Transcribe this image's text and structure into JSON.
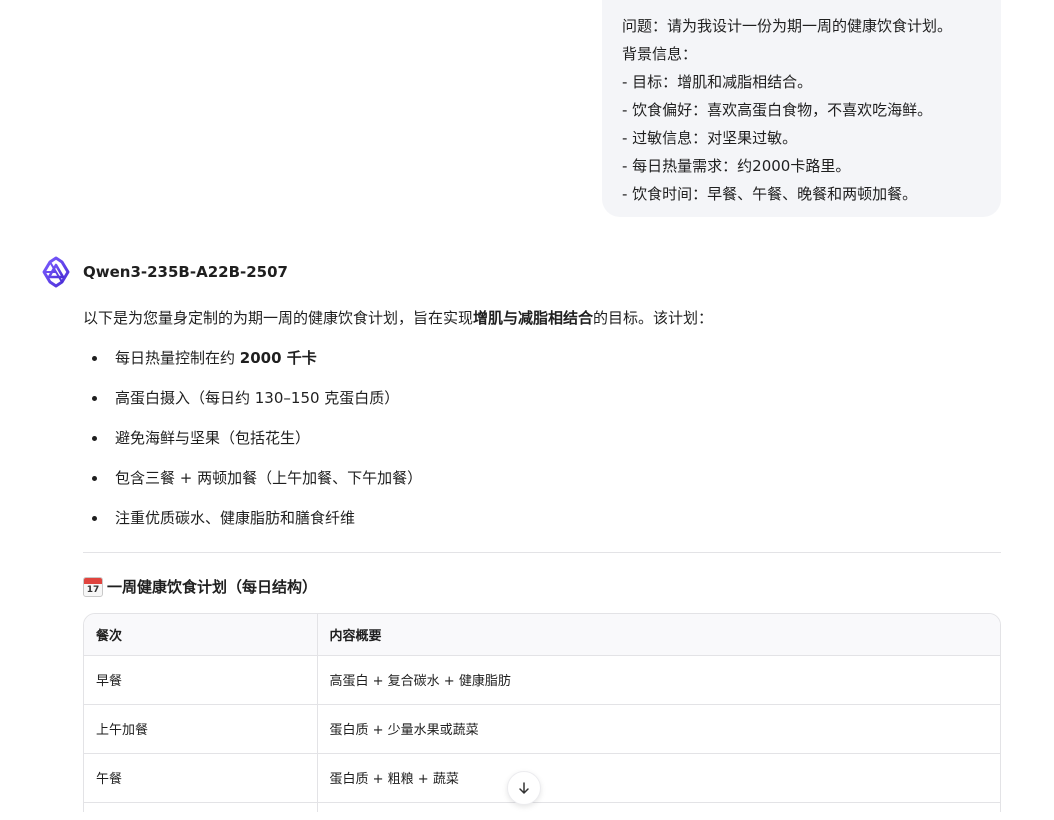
{
  "user_message": {
    "lines": [
      "问题：请为我设计一份为期一周的健康饮食计划。",
      "背景信息：",
      "- 目标：增肌和减脂相结合。",
      "- 饮食偏好：喜欢高蛋白食物，不喜欢吃海鲜。",
      "- 过敏信息：对坚果过敏。",
      "- 每日热量需求：约2000卡路里。",
      "- 饮食时间：早餐、午餐、晚餐和两顿加餐。"
    ]
  },
  "assistant": {
    "model_name": "Qwen3-235B-A22B-2507",
    "logo_icon": "qwen-logo-icon",
    "intro_before": "以下是为您量身定制的为期一周的健康饮食计划，旨在实现",
    "intro_bold": "增肌与减脂相结合",
    "intro_after": "的目标。该计划：",
    "bullets": [
      {
        "text": "每日热量控制在约 ",
        "bold": "2000 千卡"
      },
      {
        "text": "高蛋白摄入（每日约 130–150 克蛋白质）",
        "bold": ""
      },
      {
        "text": "避免海鲜与坚果（包括花生）",
        "bold": ""
      },
      {
        "text": "包含三餐 + 两顿加餐（上午加餐、下午加餐）",
        "bold": ""
      },
      {
        "text": "注重优质碳水、健康脂肪和膳食纤维",
        "bold": ""
      }
    ],
    "section_icon": "calendar-icon",
    "section_icon_day": "17",
    "section_title": "一周健康饮食计划（每日结构）",
    "table": {
      "headers": [
        "餐次",
        "内容概要"
      ],
      "rows": [
        [
          "早餐",
          "高蛋白 + 复合碳水 + 健康脂肪"
        ],
        [
          "上午加餐",
          "蛋白质 + 少量水果或蔬菜"
        ],
        [
          "午餐",
          "蛋白质 + 粗粮 + 蔬菜"
        ]
      ]
    }
  },
  "scroll_button_icon": "arrow-down-icon",
  "colors": {
    "user_bubble_bg": "#f4f5f8",
    "logo_purple": "#6b4cf6",
    "text": "#1f1f1f",
    "border": "#e3e3e6"
  }
}
